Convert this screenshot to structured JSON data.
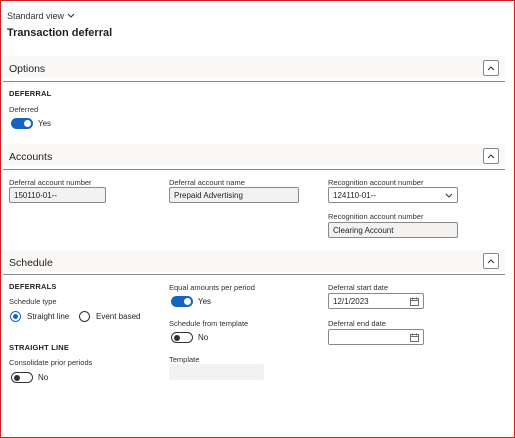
{
  "header": {
    "view_label": "Standard view",
    "page_title": "Transaction deferral"
  },
  "options": {
    "section_title": "Options",
    "group_title": "DEFERRAL",
    "deferred_label": "Deferred",
    "deferred_value": "Yes",
    "deferred_on": true
  },
  "accounts": {
    "section_title": "Accounts",
    "deferral_account_number_label": "Deferral account number",
    "deferral_account_number_value": "150110-01--",
    "deferral_account_name_label": "Deferral account name",
    "deferral_account_name_value": "Prepaid Advertising",
    "recognition_account_number_label": "Recognition account number",
    "recognition_account_number_value": "124110-01--",
    "recognition_account_name_label": "Recognition account number",
    "recognition_account_name_value": "Clearing Account"
  },
  "schedule": {
    "section_title": "Schedule",
    "deferrals_title": "DEFERRALS",
    "schedule_type_label": "Schedule type",
    "option_straight_line": "Straight line",
    "option_event_based": "Event based",
    "selected_option": "Straight line",
    "straight_line_title": "STRAIGHT LINE",
    "consolidate_label": "Consolidate prior periods",
    "consolidate_value": "No",
    "equal_amounts_label": "Equal amounts per period",
    "equal_amounts_value": "Yes",
    "schedule_from_template_label": "Schedule from template",
    "schedule_from_template_value": "No",
    "template_label": "Template",
    "template_value": "",
    "deferral_start_date_label": "Deferral start date",
    "deferral_start_date_value": "12/1/2023",
    "deferral_end_date_label": "Deferral end date",
    "deferral_end_date_value": ""
  },
  "colors": {
    "accent": "#1565c0",
    "frame_border": "#d91c1c",
    "field_background": "#f3f2f1"
  },
  "icons": [
    "chevron-down-icon",
    "chevron-up-icon",
    "calendar-icon"
  ]
}
